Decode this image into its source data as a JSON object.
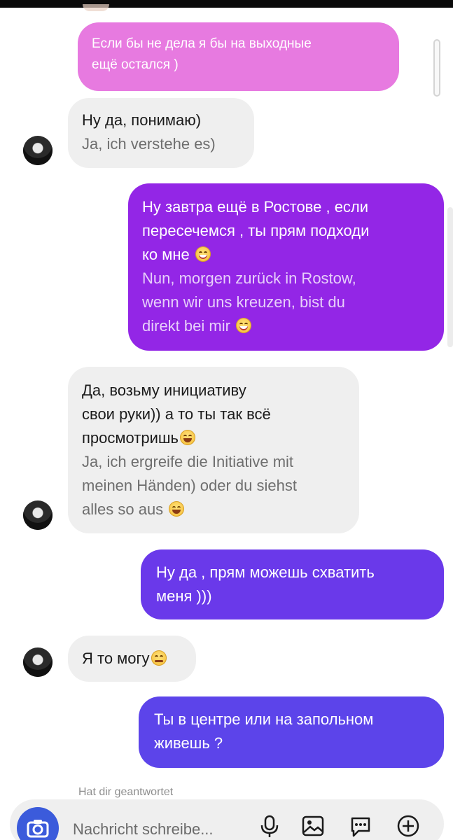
{
  "conversation": {
    "messages": [
      {
        "side": "sent",
        "lines": [
          "Если бы не дела я бы на выходные",
          "ещё остался )"
        ],
        "translation": []
      },
      {
        "side": "received",
        "lines": [
          "Ну да, понимаю)"
        ],
        "translation": [
          "Ja, ich verstehe es)"
        ]
      },
      {
        "side": "sent",
        "lines": [
          "Ну завтра ещё в Ростове , если",
          "пересечемся , ты прям подходи",
          "ко мне"
        ],
        "translation": [
          "Nun, morgen zurück in Rostow,",
          "wenn wir uns kreuzen, bist du",
          "direkt bei mir"
        ]
      },
      {
        "side": "received",
        "lines": [
          "Да, возьму инициативу",
          "свои руки)) а то ты так всё",
          "просмотришь"
        ],
        "translation": [
          "Ja, ich ergreife die Initiative mit",
          "meinen Händen) oder du siehst",
          "alles so aus"
        ]
      },
      {
        "side": "sent",
        "lines": [
          "Ну да , прям можешь схватить",
          "меня )))"
        ],
        "translation": []
      },
      {
        "side": "received",
        "lines": [
          "Я то могу"
        ],
        "translation": []
      },
      {
        "side": "sent",
        "lines": [
          "Ты в центре или на запольном",
          "живешь ?"
        ],
        "translation": []
      }
    ],
    "reply_status": "Hat dir geantwortet"
  },
  "composer": {
    "placeholder": "Nachricht schreibe...",
    "icons": [
      "camera-icon",
      "microphone-icon",
      "gallery-icon",
      "sticker-icon",
      "plus-icon"
    ]
  },
  "colors": {
    "bubble_gradient": [
      "#e77ae0",
      "#9326e6",
      "#7a2ef0",
      "#6a39ea",
      "#5e40ec",
      "#5c44ea"
    ],
    "received_bubble": "#efefef",
    "camera_button": "#3b5bdb"
  }
}
